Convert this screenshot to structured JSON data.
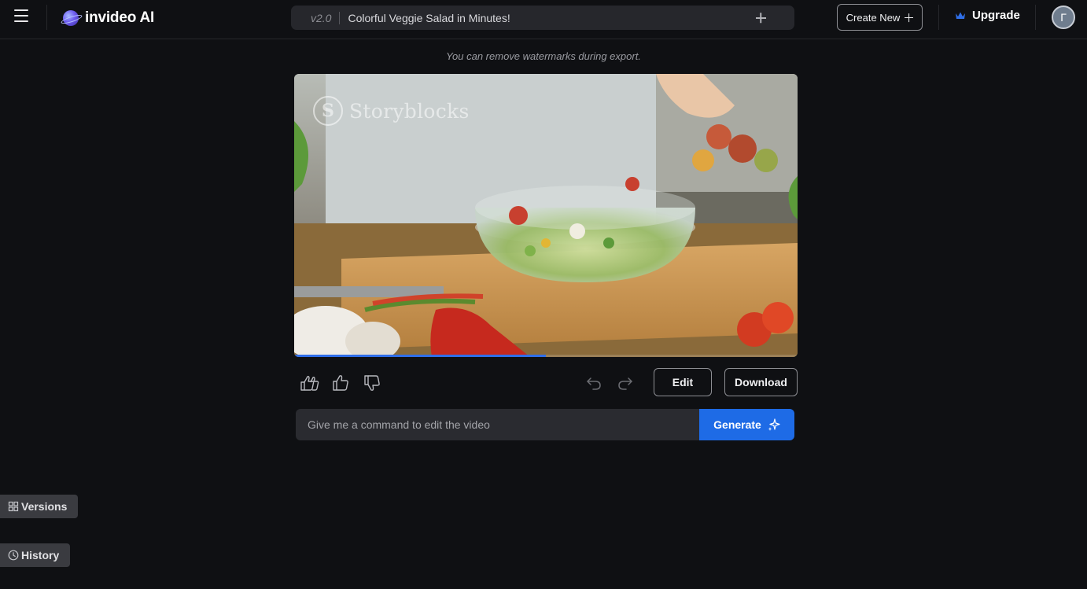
{
  "header": {
    "logo_text": "invideo AI",
    "version": "v2.0",
    "project_title": "Colorful Veggie Salad in Minutes!",
    "create_new_label": "Create New",
    "upgrade_label": "Upgrade",
    "avatar_initial": "Г"
  },
  "main": {
    "watermark_note": "You can remove watermarks during export.",
    "video": {
      "watermark_brand": "Storyblocks",
      "watermark_glyph": "S",
      "progress": 0.5
    },
    "actions": {
      "edit_label": "Edit",
      "download_label": "Download"
    },
    "command": {
      "placeholder": "Give me a command to edit the video",
      "generate_label": "Generate"
    }
  },
  "side": {
    "versions_label": "Versions",
    "history_label": "History"
  },
  "colors": {
    "background": "#0f1013",
    "accent": "#1e6be6",
    "progress": "#2f6ee8",
    "crown": "#2f6ee8"
  },
  "icons": [
    "menu-icon",
    "logo-icon",
    "plus-icon",
    "crown-icon",
    "love-it-icon",
    "thumbs-up-icon",
    "thumbs-down-icon",
    "undo-icon",
    "redo-icon",
    "sparkle-icon",
    "grid-icon",
    "clock-icon"
  ]
}
